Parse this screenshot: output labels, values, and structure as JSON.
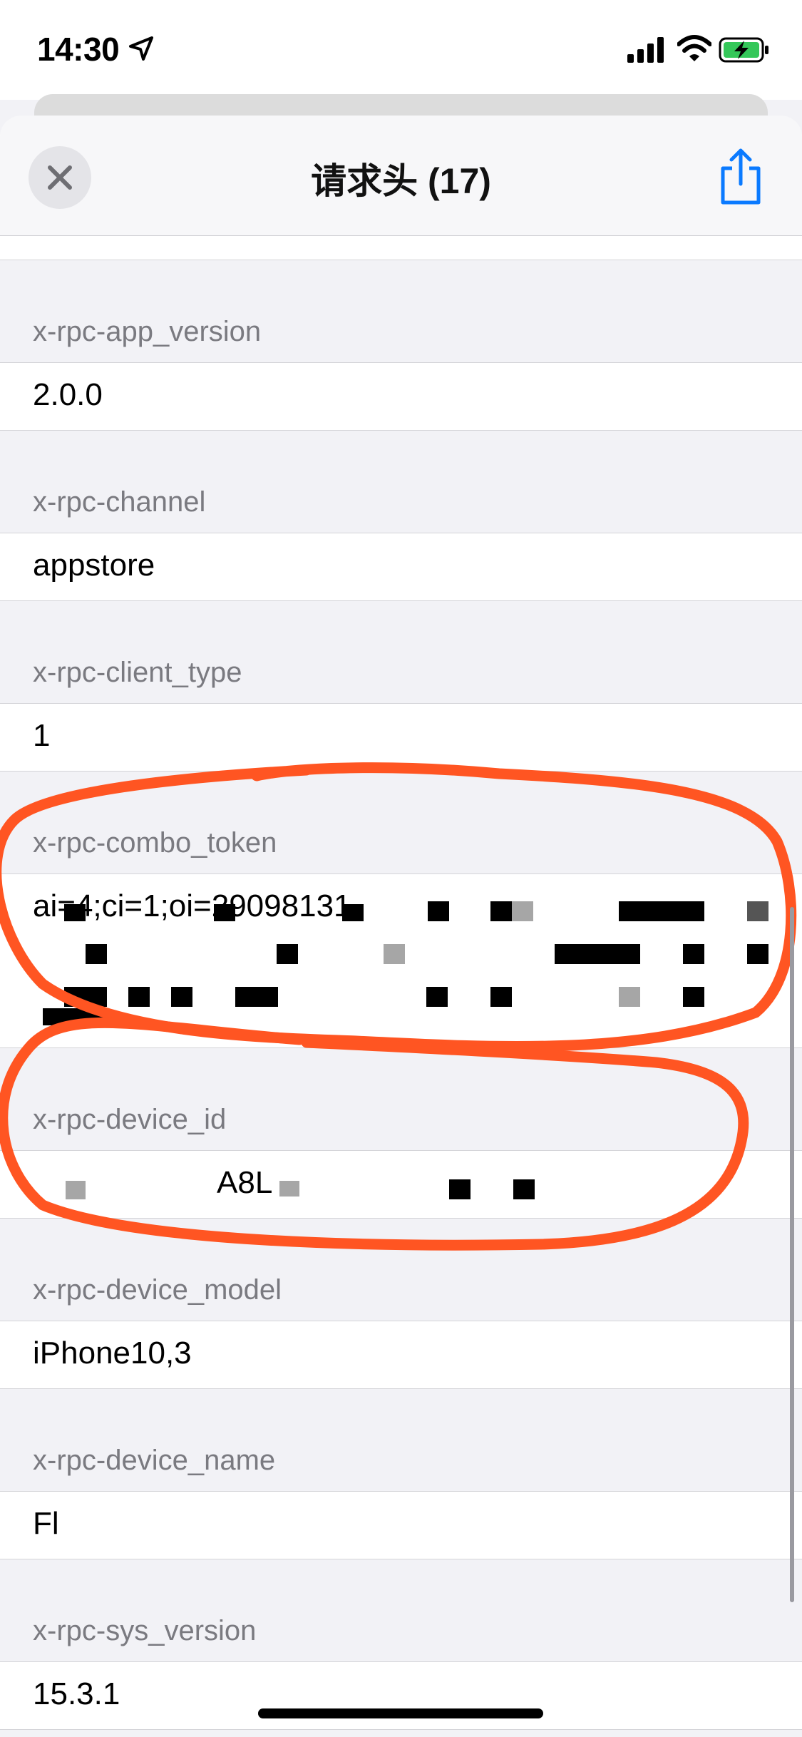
{
  "status_bar": {
    "time": "14:30"
  },
  "nav": {
    "title": "请求头 (17)"
  },
  "headers": [
    {
      "key": "x-rpc-app_version",
      "value": "2.0.0"
    },
    {
      "key": "x-rpc-channel",
      "value": "appstore"
    },
    {
      "key": "x-rpc-client_type",
      "value": "1"
    },
    {
      "key": "x-rpc-combo_token",
      "value": "ai=4;ci=1;oi=29098131"
    },
    {
      "key": "x-rpc-device_id",
      "value": "A8L"
    },
    {
      "key": "x-rpc-device_model",
      "value": "iPhone10,3"
    },
    {
      "key": "x-rpc-device_name",
      "value": "Fl"
    },
    {
      "key": "x-rpc-sys_version",
      "value": "15.3.1"
    }
  ],
  "colors": {
    "annotation": "#ff5522",
    "accent": "#0a7aff",
    "battery": "#34c759"
  }
}
